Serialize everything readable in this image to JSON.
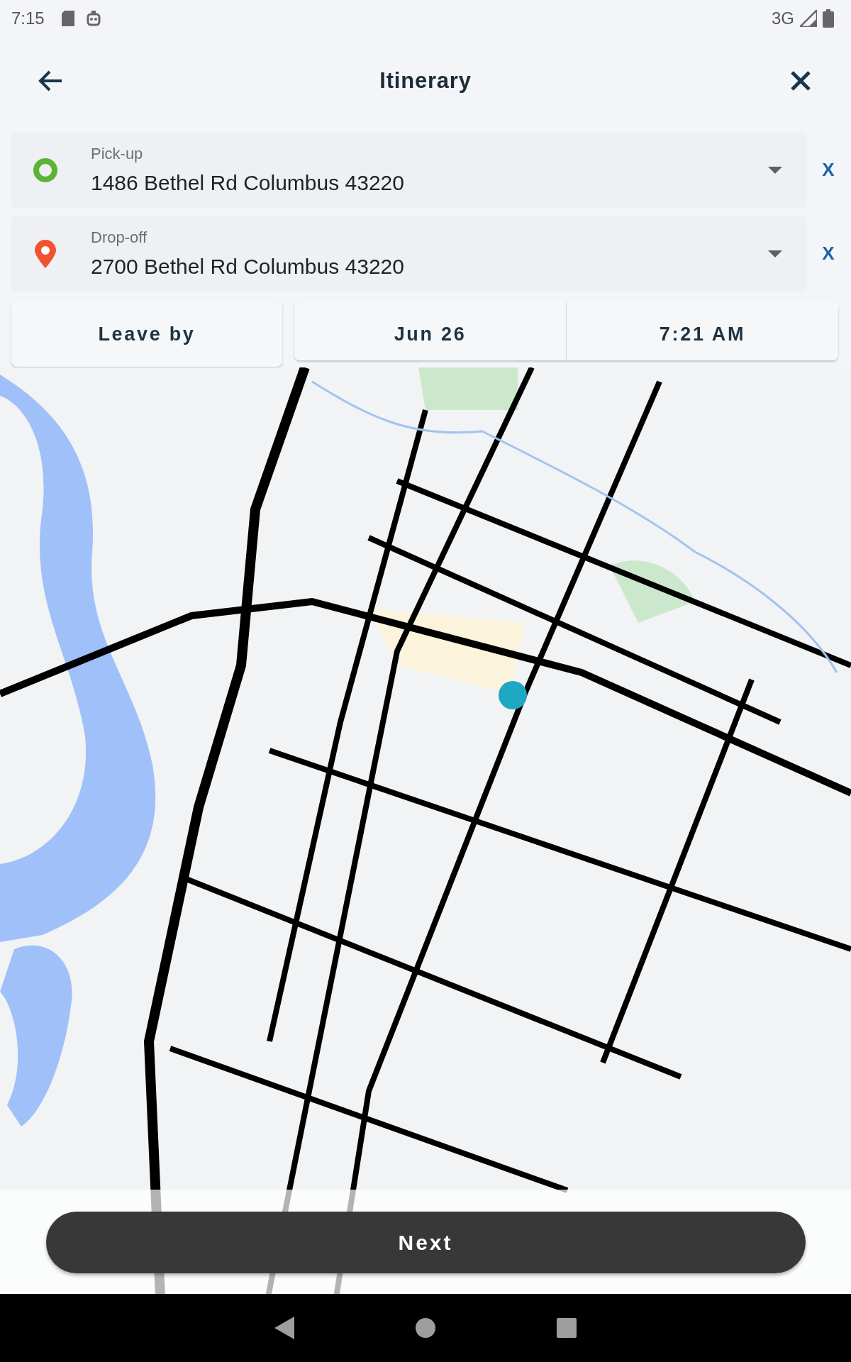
{
  "status_bar": {
    "time": "7:15",
    "network": "3G"
  },
  "header": {
    "title": "Itinerary"
  },
  "stops": [
    {
      "kind": "pickup",
      "label": "Pick-up",
      "address": "1486 Bethel Rd Columbus 43220",
      "clear": "X"
    },
    {
      "kind": "dropoff",
      "label": "Drop-off",
      "address": "2700 Bethel Rd Columbus 43220",
      "clear": "X"
    }
  ],
  "timing": {
    "mode": "Leave by",
    "date": "Jun 26",
    "time": "7:21 AM"
  },
  "next_button": "Next"
}
